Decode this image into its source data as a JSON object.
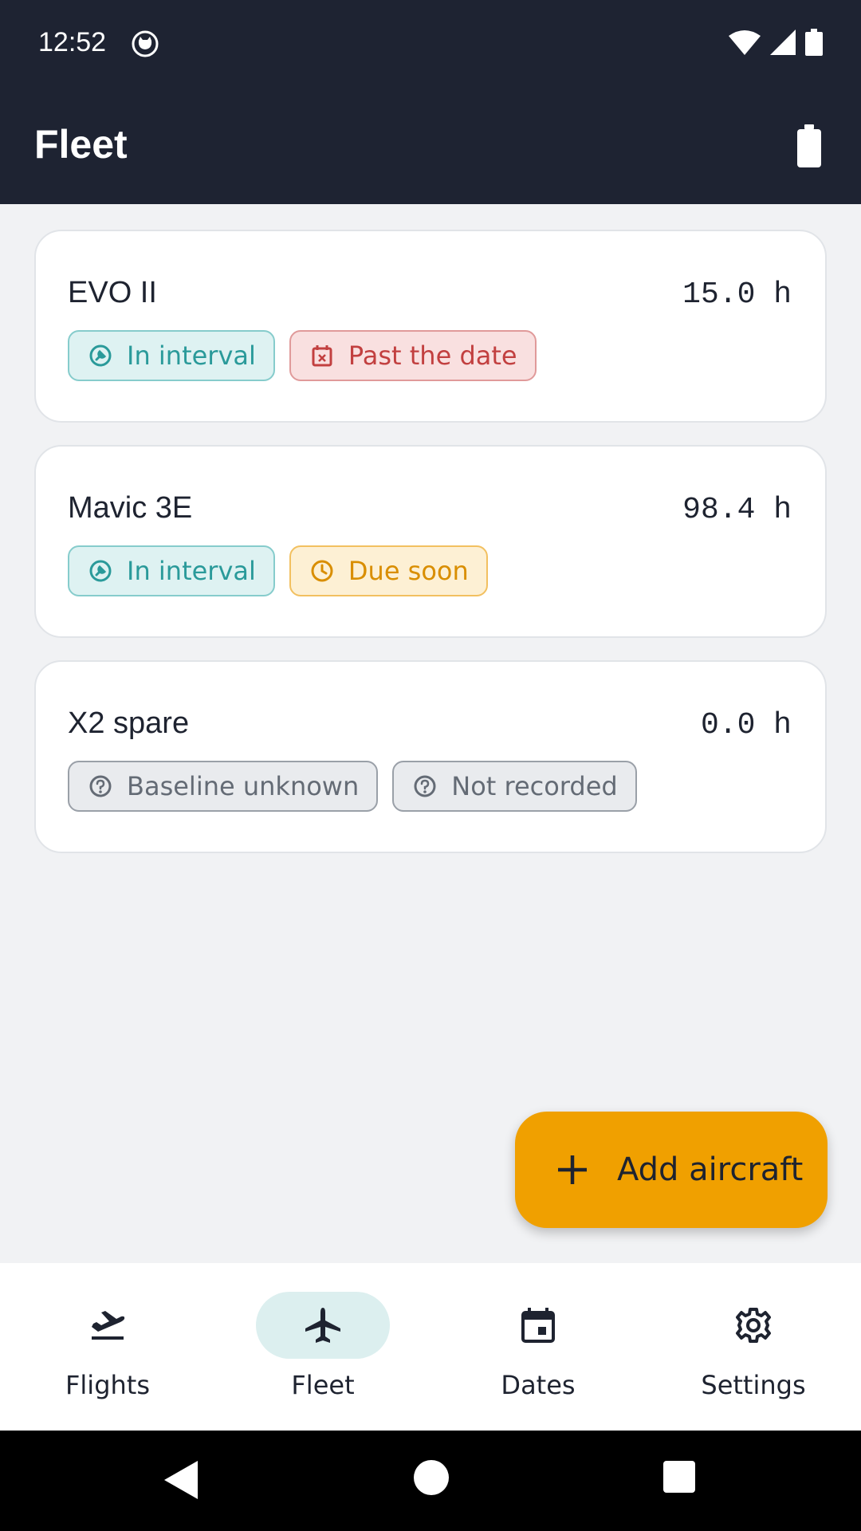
{
  "status_bar": {
    "time": "12:52"
  },
  "app_bar": {
    "title": "Fleet"
  },
  "aircraft": [
    {
      "name": "EVO II",
      "hours": "15.0 h",
      "chips": [
        {
          "label": "In interval",
          "tone": "teal",
          "icon": "wrench-icon"
        },
        {
          "label": "Past the date",
          "tone": "red",
          "icon": "calendar-x-icon"
        }
      ]
    },
    {
      "name": "Mavic 3E",
      "hours": "98.4 h",
      "chips": [
        {
          "label": "In interval",
          "tone": "teal",
          "icon": "wrench-icon"
        },
        {
          "label": "Due soon",
          "tone": "amber",
          "icon": "clock-icon"
        }
      ]
    },
    {
      "name": "X2 spare",
      "hours": "0.0 h",
      "chips": [
        {
          "label": "Baseline unknown",
          "tone": "gray",
          "icon": "help-icon"
        },
        {
          "label": "Not recorded",
          "tone": "gray",
          "icon": "help-icon"
        }
      ]
    }
  ],
  "fab": {
    "label": "Add aircraft"
  },
  "nav": [
    {
      "label": "Flights",
      "icon": "flight-takeoff-icon",
      "active": false
    },
    {
      "label": "Fleet",
      "icon": "airplane-icon",
      "active": true
    },
    {
      "label": "Dates",
      "icon": "calendar-icon",
      "active": false
    },
    {
      "label": "Settings",
      "icon": "gear-icon",
      "active": false
    }
  ],
  "colors": {
    "header": "#1e2332",
    "accent": "#f0a000",
    "teal": "#2a9a9a",
    "red": "#c24040",
    "amber": "#d98e00",
    "gray": "#646b75"
  }
}
